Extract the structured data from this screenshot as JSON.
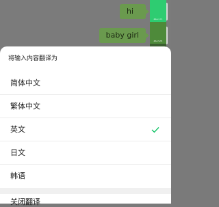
{
  "chat": {
    "messages": [
      {
        "text": "hi"
      },
      {
        "text": "baby girl"
      }
    ]
  },
  "swatches": [
    {
      "color": "#2ecc71",
      "label": "#2ecc71"
    },
    {
      "color": "#4e8a3a",
      "label": "#4e7a35"
    },
    {
      "color": "#3b5e30",
      "label": "#3b5b2e"
    },
    {
      "color": "#f2f2f2",
      "label": "#f2f2f2"
    },
    {
      "color": "#6b6b6b",
      "label": "#6b6b6b"
    }
  ],
  "sheet": {
    "title": "将输入内容翻译为",
    "options": [
      {
        "label": "简体中文",
        "selected": false
      },
      {
        "label": "繁体中文",
        "selected": false
      },
      {
        "label": "英文",
        "selected": true
      },
      {
        "label": "日文",
        "selected": false
      },
      {
        "label": "韩语",
        "selected": false
      }
    ],
    "more_label": "关闭翻译",
    "check_color": "#07c160"
  }
}
